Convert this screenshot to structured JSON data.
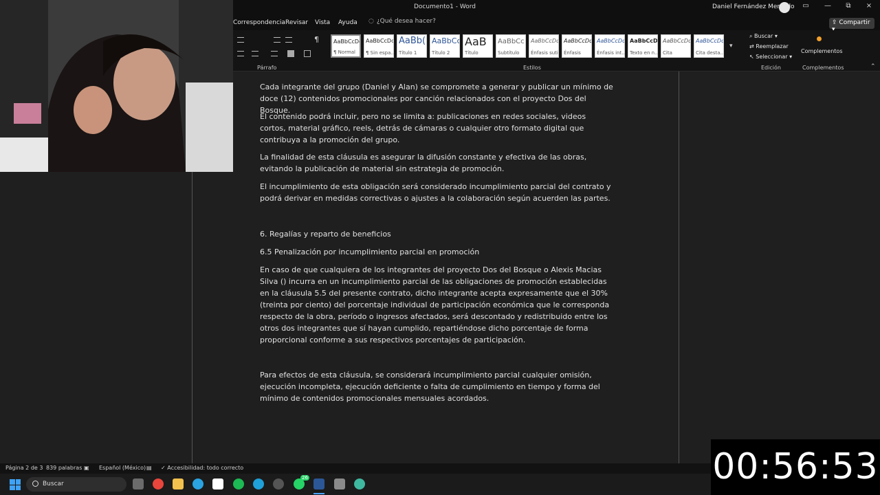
{
  "titlebar": {
    "doc_title": "Documento1 - Word",
    "user_name": "Daniel Fernández Mercado",
    "buttons": [
      "▭",
      "⧉",
      "×"
    ]
  },
  "ribbon": {
    "tabs": [
      "Correspondencia",
      "Revisar",
      "Vista",
      "Ayuda"
    ],
    "tell_me": "¿Qué desea hacer?",
    "share": "Compartir",
    "groups": {
      "parrafo": "Párrafo",
      "estilos": "Estilos",
      "edicion": "Edición",
      "complementos": "Complementos"
    },
    "styles": [
      {
        "sample": "AaBbCcDc",
        "name": "¶ Normal"
      },
      {
        "sample": "AaBbCcDc",
        "name": "¶ Sin espa..."
      },
      {
        "sample": "AaBb(",
        "name": "Título 1"
      },
      {
        "sample": "AaBbCc",
        "name": "Título 2"
      },
      {
        "sample": "AaB",
        "name": "Título"
      },
      {
        "sample": "AaBbCc",
        "name": "Subtítulo"
      },
      {
        "sample": "AaBbCcDc",
        "name": "Énfasis sutil"
      },
      {
        "sample": "AaBbCcDc",
        "name": "Énfasis"
      },
      {
        "sample": "AaBbCcDc",
        "name": "Énfasis int..."
      },
      {
        "sample": "AaBbCcDc",
        "name": "Texto en n..."
      },
      {
        "sample": "AaBbCcDc",
        "name": "Cita"
      },
      {
        "sample": "AaBbCcDc",
        "name": "Cita desta..."
      }
    ],
    "editing": {
      "buscar": "Buscar",
      "reemplazar": "Reemplazar",
      "seleccionar": "Seleccionar"
    },
    "complementos_btn": "Complementos"
  },
  "document": {
    "paragraphs": [
      "Cada integrante del grupo (Daniel y Alan) se compromete a generar y publicar un mínimo de doce (12) contenidos promocionales por canción relacionados con el proyecto Dos del Bosque.",
      "El contenido podrá incluir, pero no se limita a: publicaciones en redes sociales, videos cortos, material gráfico, reels, detrás de cámaras o cualquier otro formato digital que contribuya a la promoción del grupo.",
      "La finalidad de esta cláusula es asegurar la difusión constante y efectiva de las obras, evitando la publicación de material sin estrategia de promoción.",
      "El incumplimiento de esta obligación será considerado incumplimiento parcial del contrato y podrá derivar en medidas correctivas o ajustes a la colaboración según acuerden las partes.",
      "6. Regalías y reparto de beneficios",
      "6.5 Penalización por incumplimiento parcial en promoción",
      "En caso de que cualquiera de los integrantes del proyecto Dos del Bosque o Alexis Macias Silva () incurra en un incumplimiento parcial de las obligaciones de promoción establecidas en la cláusula 5.5 del presente contrato, dicho integrante acepta expresamente que el 30% (treinta por ciento) del porcentaje individual de participación económica que le corresponda respecto de la obra, período o ingresos afectados, será descontado y redistribuido entre los otros dos integrantes que sí hayan cumplido, repartiéndose dicho porcentaje de forma proporcional conforme a sus respectivos porcentajes de participación.",
      "Para efectos de esta cláusula, se considerará incumplimiento parcial cualquier omisión, ejecución incompleta, ejecución deficiente o falta de cumplimiento en tiempo y forma del mínimo de contenidos promocionales mensuales acordados."
    ]
  },
  "statusbar": {
    "page": "Página 2 de 3",
    "words": "839 palabras",
    "language": "Español (México)",
    "accessibility": "Accesibilidad: todo correcto"
  },
  "taskbar": {
    "search": "Buscar",
    "badge": "26"
  },
  "overlay": {
    "timer": "00:56:53"
  }
}
